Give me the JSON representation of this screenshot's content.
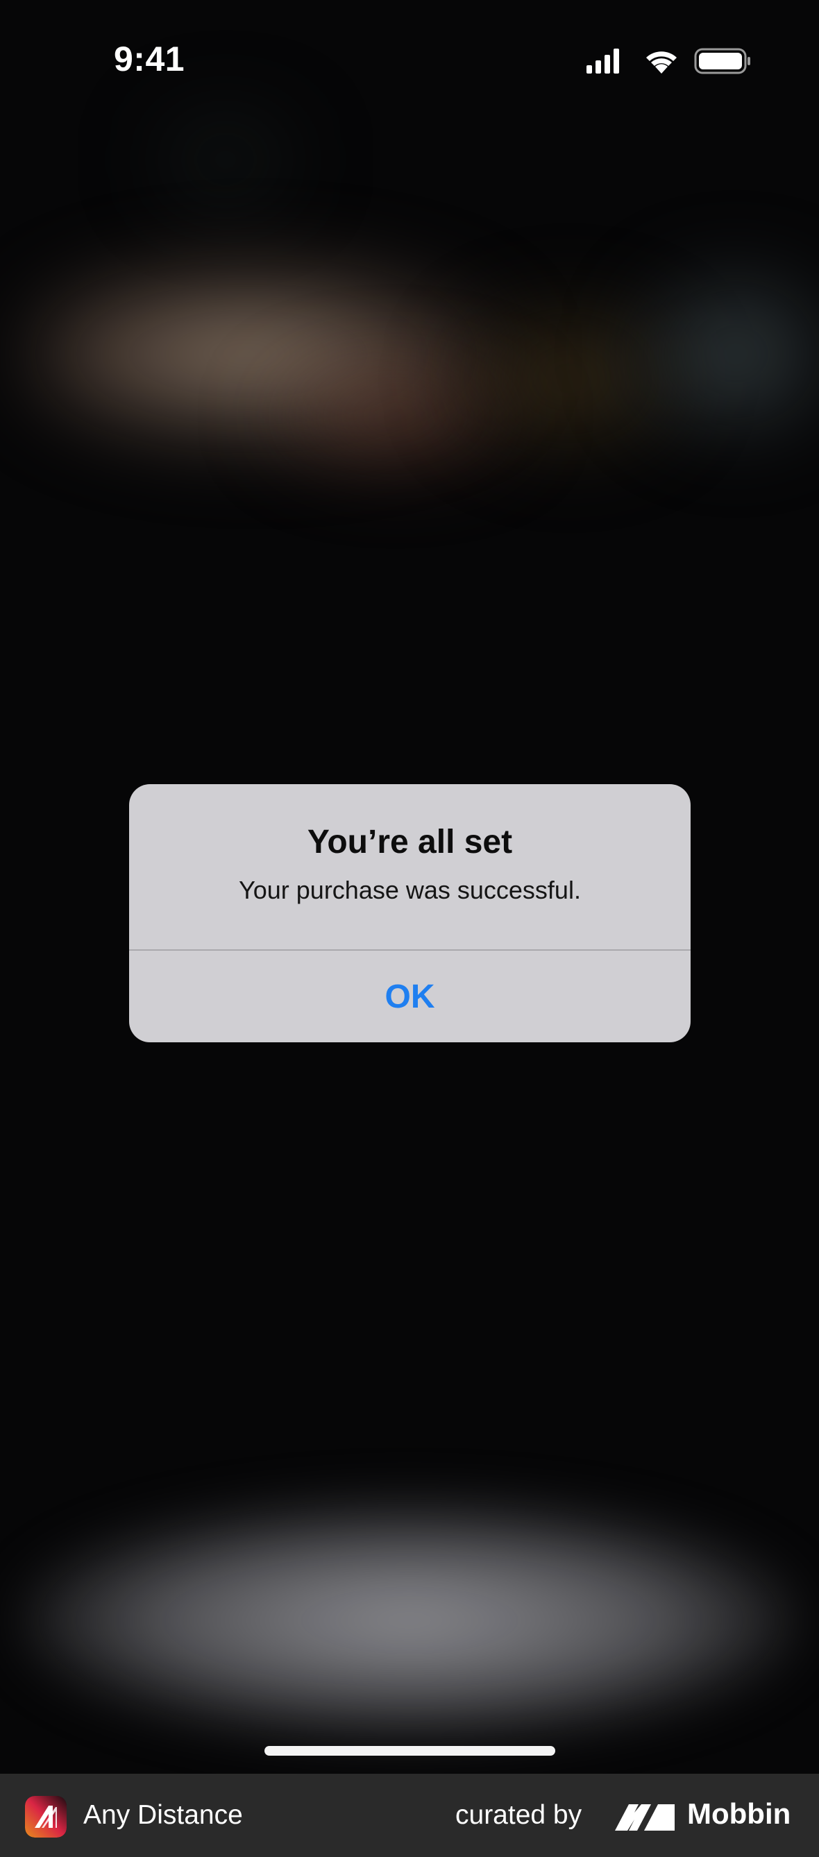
{
  "status_bar": {
    "time": "9:41",
    "icons": [
      "cellular-signal-icon",
      "wifi-icon",
      "battery-icon"
    ]
  },
  "alert": {
    "title": "You’re all set",
    "message": "Your purchase was successful.",
    "ok_label": "OK",
    "ok_color": "#1f7ff0"
  },
  "footer": {
    "app_name": "Any Distance",
    "curated_label": "curated by",
    "brand_name": "Mobbin"
  }
}
